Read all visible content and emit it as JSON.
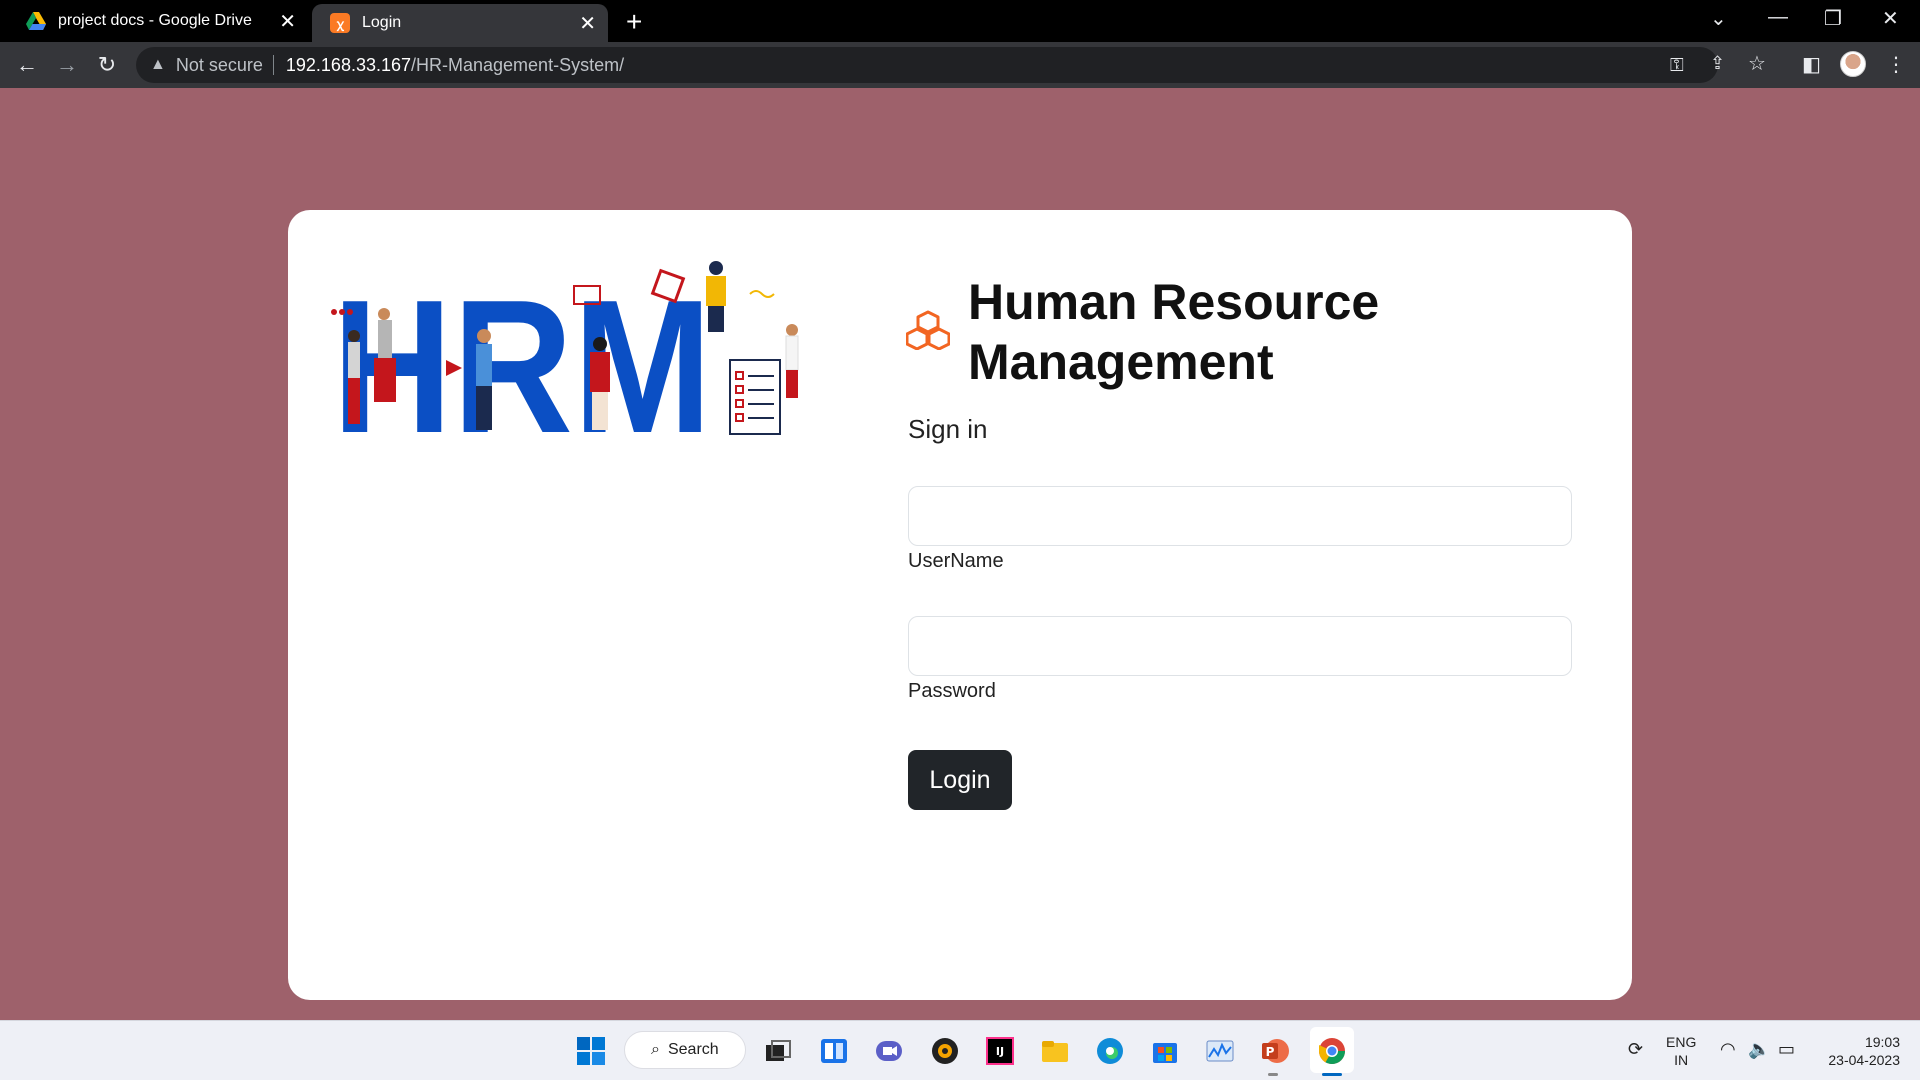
{
  "browser": {
    "tabs": [
      {
        "title": "project docs - Google Drive",
        "active": false
      },
      {
        "title": "Login",
        "active": true
      }
    ],
    "address": {
      "security_label": "Not secure",
      "host": "192.168.33.167",
      "path": "/HR-Management-System/"
    }
  },
  "login": {
    "title": "Human Resource Management",
    "subtitle": "Sign in",
    "username_label": "UserName",
    "username_value": "",
    "password_label": "Password",
    "password_value": "",
    "login_label": "Login",
    "illustration_text": "HRM"
  },
  "taskbar": {
    "search_label": "Search",
    "language_line1": "ENG",
    "language_line2": "IN",
    "time": "19:03",
    "date": "23-04-2023"
  },
  "colors": {
    "background": "#9e616b",
    "button": "#212529",
    "brand_icon": "#f26522",
    "hrm_blue": "#0b4fc4"
  }
}
